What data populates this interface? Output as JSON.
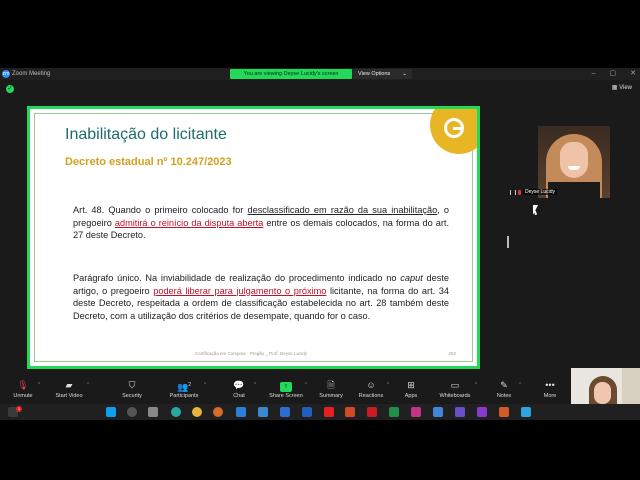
{
  "window": {
    "title": "Zoom Meeting",
    "app_icon_label": "zm",
    "viewing_banner": "You are viewing Deyse Lucidy's screen",
    "view_options_label": "View Options",
    "minimize_label": "–",
    "maximize_label": "▢",
    "close_label": "✕"
  },
  "meeting": {
    "view_label": "View"
  },
  "slide": {
    "title": "Inabilitação do licitante",
    "subtitle": "Decreto estadual nº 10.247/2023",
    "p1": {
      "a": "Art. 48.  Quando o primeiro colocado for ",
      "b": "desclassificado em razão da sua inabilitação",
      "c": ", o pregoeiro ",
      "d": "admitirá o reinício da disputa aberta",
      "e": " entre os demais colocados, na forma do art. 27 deste Decreto."
    },
    "p2": {
      "a": "Parágrafo único.  Na inviabilidade de realização do procedimento indicado no ",
      "b": "caput",
      "c": " deste artigo, o pregoeiro ",
      "d": "poderá liberar para julgamento o próximo",
      "e": " licitante, na forma do art. 34 deste Decreto, respeitada a ordem de classificação estabelecida no art. 28 também deste Decreto, com a utilização dos critérios de desempate, quando for o caso."
    },
    "footer": "Certificação em Compras - Pregão _ Prof. Deyse Lucidy",
    "page": "252"
  },
  "participant": {
    "name": "Deyse Lucidy"
  },
  "toolbar": {
    "unmute": "Unmute",
    "start_video": "Start Video",
    "security": "Security",
    "participants": "Participants",
    "participants_count": "2",
    "chat": "Chat",
    "share_screen": "Share Screen",
    "summary": "Summary",
    "reactions": "Reactions",
    "apps": "Apps",
    "whiteboards": "Whiteboards",
    "notes": "Notes",
    "more": "More"
  },
  "taskbar": {
    "badge": "1"
  },
  "colors": {
    "share_border": "#23d959",
    "title": "#1e6b6b",
    "subtitle": "#d4a020",
    "emphasis": "#c0102a",
    "logo": "#e8b624"
  }
}
